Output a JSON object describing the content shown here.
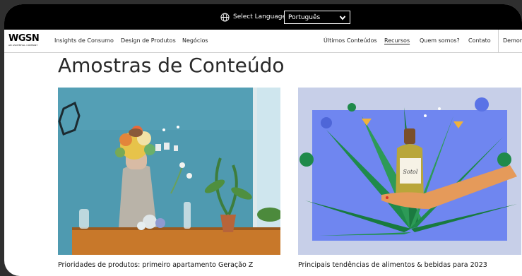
{
  "language_bar": {
    "label": "Select Language:",
    "selected": "Português"
  },
  "logo": {
    "mark": "WGSN",
    "sub": "AN ASCENTIAL COMPANY"
  },
  "nav": {
    "left_items": [
      "Insights de Consumo",
      "Design de Produtos",
      "Negócios"
    ],
    "right_items": [
      "Últimos Conteúdos",
      "Recursos",
      "Quem somos?",
      "Contato",
      "Demon"
    ],
    "active": "Recursos"
  },
  "page": {
    "heading": "Amostras de Conteúdo"
  },
  "cards": [
    {
      "caption": "Prioridades de produtos: primeiro apartamento Geração Z",
      "image": "florist-photo"
    },
    {
      "caption": "Principais tendências de alimentos & bebidas para 2023",
      "image": "tequila-illustration",
      "bottle_label": "Sotol"
    }
  ],
  "colors": {
    "bar_bg": "#000000",
    "illustration_bg": "#6f86f0",
    "leaf_green": "#1f8a4a",
    "wall_blue": "#4f9ab0",
    "table_orange": "#c8782a"
  }
}
